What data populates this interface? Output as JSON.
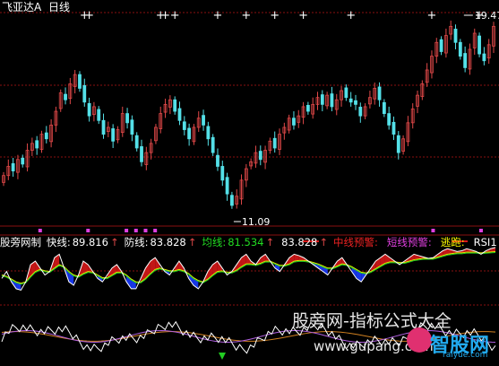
{
  "colors": {
    "bg": "#000000",
    "up": "#e04848",
    "down": "#54e0e8",
    "grid": "#8a1010",
    "white": "#ffffff",
    "blue_fill": "#1a3cff",
    "red_fill": "#d81818",
    "green_line": "#22cc22",
    "yellow_line": "#e8e800",
    "magenta": "#e040e0",
    "purple_line": "#b060e0",
    "orange_line": "#d08020"
  },
  "header": {
    "stock_name": "飞亚达A",
    "period": "日线"
  },
  "price_chart": {
    "high_label": "19.47",
    "low_label": "11.09"
  },
  "indicator": {
    "name": "股旁网制",
    "items": [
      {
        "label": "快线:",
        "value": "89.816",
        "arrow": "↑",
        "color": "#ffffff"
      },
      {
        "label": "防线:",
        "value": "83.828",
        "arrow": "↑",
        "color": "#ffffff"
      },
      {
        "label": "均线:",
        "value": "81.534",
        "arrow": "↑",
        "color": "#22dd22"
      },
      {
        "label": "",
        "value": "83.828",
        "arrow": "↑",
        "color": "#ffffff"
      },
      {
        "label": "中线预警:",
        "value": "",
        "arrow": "",
        "color": "#ee2222"
      },
      {
        "label": "短线预警:",
        "value": "",
        "arrow": "",
        "color": "#e040e0"
      },
      {
        "label": "逃跑:",
        "value": "",
        "arrow": "",
        "color": "#ffff00"
      },
      {
        "label": "RSI1",
        "value": "",
        "arrow": "",
        "color": "#ffffff"
      }
    ]
  },
  "watermark": {
    "title": "股旁网-指标公式大全",
    "url": "www.gupang.com",
    "logo_text": "智股网",
    "logo_domain": "raiyue.com"
  },
  "chart_data": {
    "type": "candlestick",
    "price_range": [
      10.6,
      19.9
    ],
    "closes": [
      12.8,
      13.2,
      13.0,
      13.5,
      13.3,
      13.9,
      14.2,
      14.0,
      14.6,
      14.4,
      15.0,
      15.6,
      16.4,
      16.1,
      16.8,
      17.2,
      16.6,
      16.0,
      15.4,
      15.8,
      15.2,
      14.6,
      14.9,
      14.3,
      14.8,
      15.5,
      15.1,
      14.6,
      14.0,
      13.4,
      13.8,
      14.2,
      14.9,
      15.5,
      15.9,
      16.1,
      15.6,
      15.2,
      14.8,
      14.4,
      14.9,
      15.3,
      15.0,
      14.4,
      13.8,
      13.2,
      12.6,
      12.0,
      11.5,
      11.9,
      12.6,
      13.1,
      13.4,
      13.8,
      13.5,
      13.9,
      14.3,
      14.0,
      14.6,
      14.9,
      15.3,
      15.0,
      15.4,
      15.8,
      15.6,
      15.9,
      16.2,
      15.9,
      16.3,
      15.8,
      16.1,
      16.5,
      16.2,
      16.0,
      15.9,
      15.4,
      15.8,
      16.2,
      16.6,
      16.1,
      15.5,
      15.0,
      14.6,
      13.8,
      14.4,
      15.1,
      15.7,
      16.3,
      16.8,
      17.4,
      18.0,
      18.6,
      18.2,
      18.9,
      19.3,
      18.6,
      18.0,
      17.5,
      18.3,
      19.0,
      18.1,
      17.8,
      18.5,
      19.3
    ],
    "signal_plus_positions": [
      17,
      18,
      33,
      34,
      36,
      45,
      51,
      57,
      63,
      73,
      90,
      100
    ],
    "ema_fast": [
      45,
      55,
      40,
      30,
      28,
      40,
      65,
      70,
      60,
      50,
      55,
      75,
      80,
      60,
      40,
      35,
      50,
      70,
      65,
      55,
      45,
      40,
      50,
      60,
      65,
      55,
      40,
      30,
      30,
      45,
      60,
      70,
      75,
      65,
      55,
      50,
      60,
      70,
      60,
      45,
      35,
      30,
      40,
      55,
      65,
      70,
      60,
      50,
      55,
      65,
      75,
      80,
      70,
      65,
      75,
      80,
      70,
      60,
      55,
      65,
      75,
      80,
      78,
      75,
      70,
      65,
      60,
      55,
      50,
      60,
      70,
      75,
      65,
      55,
      45,
      40,
      50,
      60,
      70,
      75,
      80,
      75,
      70,
      65,
      70,
      75,
      80,
      78,
      76,
      74,
      75,
      80,
      85,
      88,
      86,
      84,
      85,
      88,
      86,
      84,
      80,
      85,
      88,
      89.8
    ],
    "ema_slow": [
      50,
      48,
      44,
      40,
      38,
      40,
      48,
      55,
      58,
      56,
      55,
      60,
      65,
      62,
      55,
      50,
      48,
      52,
      55,
      54,
      50,
      46,
      46,
      50,
      54,
      54,
      50,
      44,
      40,
      40,
      45,
      52,
      58,
      60,
      58,
      56,
      56,
      58,
      56,
      52,
      46,
      42,
      40,
      44,
      50,
      55,
      56,
      54,
      54,
      57,
      62,
      66,
      66,
      65,
      67,
      70,
      70,
      67,
      64,
      64,
      66,
      70,
      71,
      71,
      70,
      68,
      66,
      63,
      60,
      60,
      63,
      66,
      65,
      62,
      58,
      54,
      53,
      55,
      59,
      63,
      67,
      69,
      69,
      68,
      68,
      70,
      72,
      73,
      74,
      74,
      74,
      76,
      78,
      80,
      81,
      82,
      82,
      83,
      83,
      83,
      82,
      82.8,
      83.3,
      83.8
    ]
  }
}
